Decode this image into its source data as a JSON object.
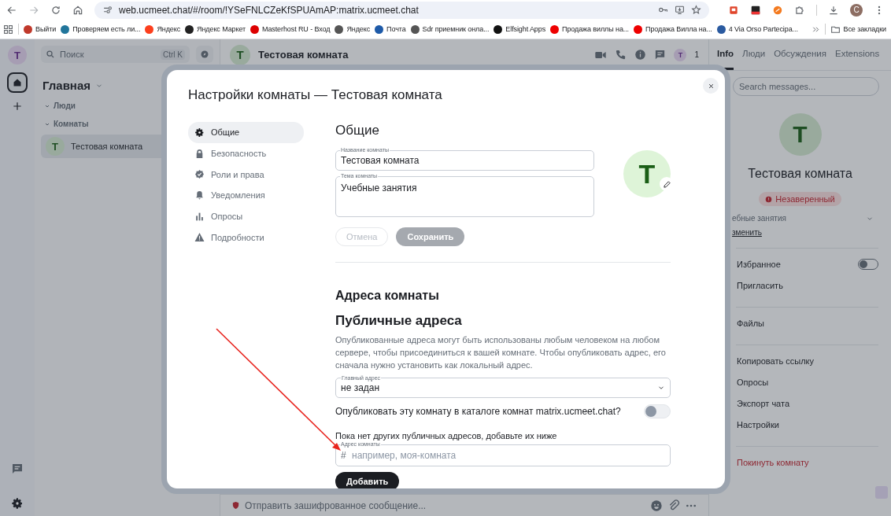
{
  "browser": {
    "url": "web.ucmeet.chat/#/room/!YSeFNLCZeKfSPUAmAP:matrix.ucmeet.chat",
    "profile": "C",
    "bookmarks": [
      {
        "label": "Выйти"
      },
      {
        "label": "Проверяем есть ли..."
      },
      {
        "label": "Яндекс"
      },
      {
        "label": "Яндекс Маркет"
      },
      {
        "label": "Masterhost RU - Вход"
      },
      {
        "label": "Яндекс"
      },
      {
        "label": "Почта"
      },
      {
        "label": "Sdr приемник онла..."
      },
      {
        "label": "Elfsight Apps"
      },
      {
        "label": "Продажа виллы на..."
      },
      {
        "label": "Продажа Вилла на..."
      },
      {
        "label": "4 Via Orso Partecipa..."
      }
    ],
    "all_bookmarks": "Все закладки"
  },
  "space_rail": {
    "avatar": "T"
  },
  "room_list": {
    "search_placeholder": "Поиск",
    "shortcut": "Ctrl K",
    "title": "Главная",
    "sections": [
      {
        "label": "Люди"
      },
      {
        "label": "Комнаты",
        "rooms": [
          {
            "name": "Тестовая комната",
            "avatar": "T",
            "selected": true
          }
        ]
      }
    ]
  },
  "room_header": {
    "avatar": "T",
    "name": "Тестовая комната",
    "member_avatar": "T",
    "member_count": "1"
  },
  "composer": {
    "placeholder": "Отправить зашифрованное сообщение..."
  },
  "right_panel": {
    "tabs": [
      {
        "label": "Info",
        "selected": true
      },
      {
        "label": "Люди",
        "selected": false
      },
      {
        "label": "Обсуждения",
        "selected": false
      },
      {
        "label": "Extensions",
        "selected": false
      }
    ],
    "search_placeholder": "Search messages...",
    "avatar": "T",
    "name": "Тестовая комната",
    "badge": "Незаверенный",
    "topic": "ебные занятия",
    "edit_link": "зменить",
    "groups": [
      [
        {
          "label": "Избранное",
          "kind": "toggle",
          "on": false
        },
        {
          "label": "Пригласить",
          "kind": "action"
        }
      ],
      [
        {
          "label": "Файлы",
          "kind": "action"
        }
      ],
      [
        {
          "label": "Копировать ссылку",
          "kind": "action"
        },
        {
          "label": "Опросы",
          "kind": "action"
        },
        {
          "label": "Экспорт чата",
          "kind": "action"
        },
        {
          "label": "Настройки",
          "kind": "action"
        }
      ],
      [
        {
          "label": "Покинуть комнату",
          "kind": "danger"
        }
      ]
    ]
  },
  "dialog": {
    "title": "Настройки комнаты — Тестовая комната",
    "nav": [
      {
        "label": "Общие",
        "selected": true
      },
      {
        "label": "Безопасность",
        "selected": false
      },
      {
        "label": "Роли и права",
        "selected": false
      },
      {
        "label": "Уведомления",
        "selected": false
      },
      {
        "label": "Опросы",
        "selected": false
      },
      {
        "label": "Подробности",
        "selected": false
      }
    ],
    "general": {
      "heading": "Общие",
      "name_label": "Название комнаты",
      "name_value": "Тестовая комната",
      "topic_label": "Тема комнаты",
      "topic_value": "Учебные занятия",
      "avatar": "T",
      "cancel": {
        "label": "Отмена",
        "disabled": true
      },
      "save": {
        "label": "Сохранить",
        "disabled": true
      }
    },
    "addresses": {
      "heading": "Адреса комнаты",
      "subheading": "Публичные адреса",
      "description": "Опубликованные адреса могут быть использованы любым человеком на любом сервере, чтобы присоединиться к вашей комнате. Чтобы опубликовать адрес, его сначала нужно установить как локальный адрес.",
      "main_label": "Главный адрес",
      "main_value": "не задан",
      "publish_label": "Опубликовать эту комнату в каталоге комнат matrix.ucmeet.chat?",
      "publish_on": false,
      "note": "Пока нет других публичных адресов, добавьте их ниже",
      "address_label": "Адрес комнаты",
      "address_prefix": "#",
      "address_placeholder": "например, моя-комната",
      "add": "Добавить"
    }
  }
}
